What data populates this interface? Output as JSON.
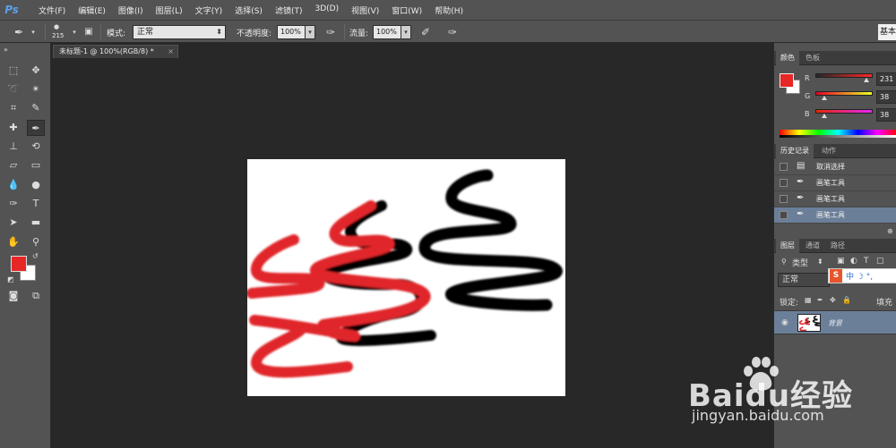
{
  "app": {
    "logo": "Ps"
  },
  "menu": [
    "文件(F)",
    "编辑(E)",
    "图像(I)",
    "图层(L)",
    "文字(Y)",
    "选择(S)",
    "滤镜(T)",
    "3D(D)",
    "视图(V)",
    "窗口(W)",
    "帮助(H)"
  ],
  "options": {
    "brush_size": "215",
    "mode_label": "模式:",
    "mode_value": "正常",
    "opacity_label": "不透明度:",
    "opacity_value": "100%",
    "flow_label": "流量:",
    "flow_value": "100%",
    "workspace": "基本"
  },
  "document": {
    "tab_title": "未标题-1 @ 100%(RGB/8) *",
    "close": "×"
  },
  "color_panel": {
    "tabs": [
      "颜色",
      "色板"
    ],
    "r_label": "R",
    "r_value": "231",
    "g_label": "G",
    "g_value": "38",
    "b_label": "B",
    "b_value": "38",
    "foreground": "#e72626",
    "background": "#ffffff"
  },
  "history_panel": {
    "tabs": [
      "历史记录",
      "动作"
    ],
    "items": [
      "取消选择",
      "画笔工具",
      "画笔工具",
      "画笔工具"
    ]
  },
  "layers_panel": {
    "tabs": [
      "图层",
      "通道",
      "路径"
    ],
    "filter_label": "类型",
    "blend_mode": "正常",
    "lock_label": "锁定:",
    "fill_label": "填充",
    "layer_name": "背景"
  },
  "ime": {
    "s": "S",
    "text": "中 ☽ °,"
  },
  "watermark": {
    "brand": "Baidu经验",
    "url": "jingyan.baidu.com"
  }
}
